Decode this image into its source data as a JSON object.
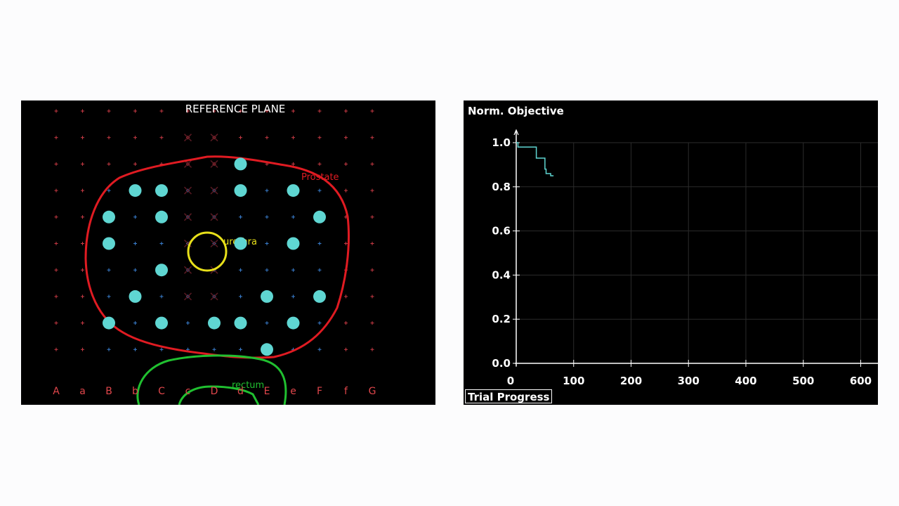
{
  "reference_plane": {
    "title": "REFERENCE PLANE",
    "organs": {
      "prostate": {
        "label": "Prostate",
        "color": "#e01b22"
      },
      "urethra": {
        "label": "urethra",
        "color": "#e8e01a"
      },
      "rectum": {
        "label": "rectum",
        "color": "#20c030"
      }
    },
    "column_labels": [
      "A",
      "a",
      "B",
      "b",
      "C",
      "c",
      "D",
      "d",
      "E",
      "e",
      "F",
      "f",
      "G"
    ],
    "seed_color": "#5fd6d2",
    "seeds": [
      {
        "col": 7,
        "row": 2
      },
      {
        "col": 3,
        "row": 3
      },
      {
        "col": 4,
        "row": 3
      },
      {
        "col": 7,
        "row": 3
      },
      {
        "col": 9,
        "row": 3
      },
      {
        "col": 2,
        "row": 4
      },
      {
        "col": 4,
        "row": 4
      },
      {
        "col": 10,
        "row": 4
      },
      {
        "col": 2,
        "row": 5
      },
      {
        "col": 7,
        "row": 5
      },
      {
        "col": 9,
        "row": 5
      },
      {
        "col": 4,
        "row": 6
      },
      {
        "col": 3,
        "row": 7
      },
      {
        "col": 8,
        "row": 7
      },
      {
        "col": 10,
        "row": 7
      },
      {
        "col": 2,
        "row": 8
      },
      {
        "col": 4,
        "row": 8
      },
      {
        "col": 6,
        "row": 8
      },
      {
        "col": 7,
        "row": 8
      },
      {
        "col": 9,
        "row": 8
      },
      {
        "col": 8,
        "row": 9
      }
    ],
    "excluded_positions": [
      {
        "col": 5,
        "row": 1
      },
      {
        "col": 6,
        "row": 1
      },
      {
        "col": 5,
        "row": 2
      },
      {
        "col": 6,
        "row": 2
      },
      {
        "col": 5,
        "row": 3
      },
      {
        "col": 6,
        "row": 3
      },
      {
        "col": 5,
        "row": 4
      },
      {
        "col": 6,
        "row": 4
      },
      {
        "col": 5,
        "row": 5
      },
      {
        "col": 6,
        "row": 5
      },
      {
        "col": 5,
        "row": 6
      },
      {
        "col": 6,
        "row": 6
      },
      {
        "col": 5,
        "row": 7
      },
      {
        "col": 6,
        "row": 7
      }
    ]
  },
  "trial_progress": {
    "button_label": "Trial Progress",
    "chart_data": {
      "type": "line",
      "title": "",
      "ylabel": "Norm. Objective",
      "xlabel": "",
      "xlim": [
        0,
        630
      ],
      "ylim": [
        0,
        1.0
      ],
      "x_ticks": [
        "0",
        "100",
        "200",
        "300",
        "400",
        "500",
        "600"
      ],
      "y_ticks": [
        "0.0",
        "0.2",
        "0.4",
        "0.6",
        "0.8",
        "1.0"
      ],
      "grid": true,
      "line_color": "#5fd6d2",
      "series": [
        {
          "x": [
            0,
            3,
            3,
            35,
            35,
            50,
            50,
            52,
            52,
            60,
            60,
            65
          ],
          "y": [
            1.0,
            1.0,
            0.98,
            0.98,
            0.93,
            0.93,
            0.88,
            0.88,
            0.86,
            0.86,
            0.85,
            0.85
          ]
        }
      ]
    }
  }
}
